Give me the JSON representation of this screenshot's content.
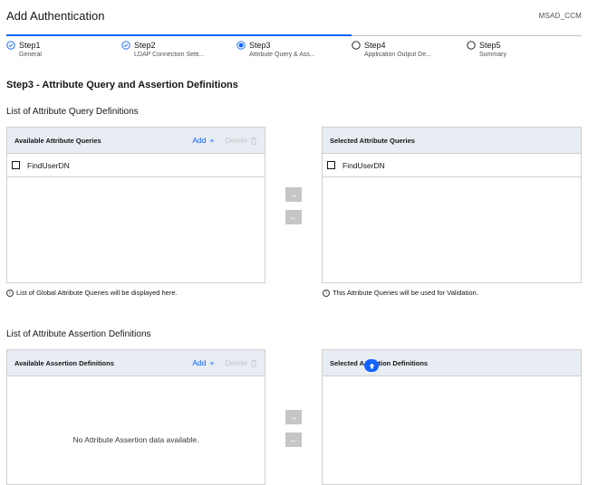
{
  "header": {
    "title": "Add Authentication",
    "app_tag": "MSAD_CCM"
  },
  "progress": {
    "completed_fraction": 0.6,
    "steps": [
      {
        "label": "Step1",
        "sub": "General",
        "state": "complete"
      },
      {
        "label": "Step2",
        "sub": "LDAP Connection Setti...",
        "state": "complete"
      },
      {
        "label": "Step3",
        "sub": "Attribute Query & Ass...",
        "state": "current"
      },
      {
        "label": "Step4",
        "sub": "Application Output De...",
        "state": "incomplete"
      },
      {
        "label": "Step5",
        "sub": "Summary",
        "state": "incomplete"
      }
    ]
  },
  "main": {
    "step_heading": "Step3 - Attribute Query and Assertion Definitions",
    "query_section": {
      "heading": "List of Attribute Query Definitions",
      "available": {
        "title": "Available Attribute Queries",
        "add_label": "Add",
        "delete_label": "Delete",
        "items": [
          "FindUserDN"
        ],
        "helper": "List of Global Attribute Queries will be displayed here."
      },
      "selected": {
        "title": "Selected Attribute Queries",
        "items": [
          "FindUserDN"
        ],
        "helper": "This Attribute Queries will be used for Validation."
      }
    },
    "assertion_section": {
      "heading": "List of Attribute Assertion Definitions",
      "available": {
        "title": "Available Assertion Definitions",
        "add_label": "Add",
        "delete_label": "Delete",
        "empty_message": "No Attribute Assertion data available."
      },
      "selected": {
        "title": "Selected Assertion Definitions"
      }
    }
  },
  "colors": {
    "accent": "#0f62fe",
    "panel_header": "#e8ecf3",
    "disabled": "#c6c6c6"
  }
}
